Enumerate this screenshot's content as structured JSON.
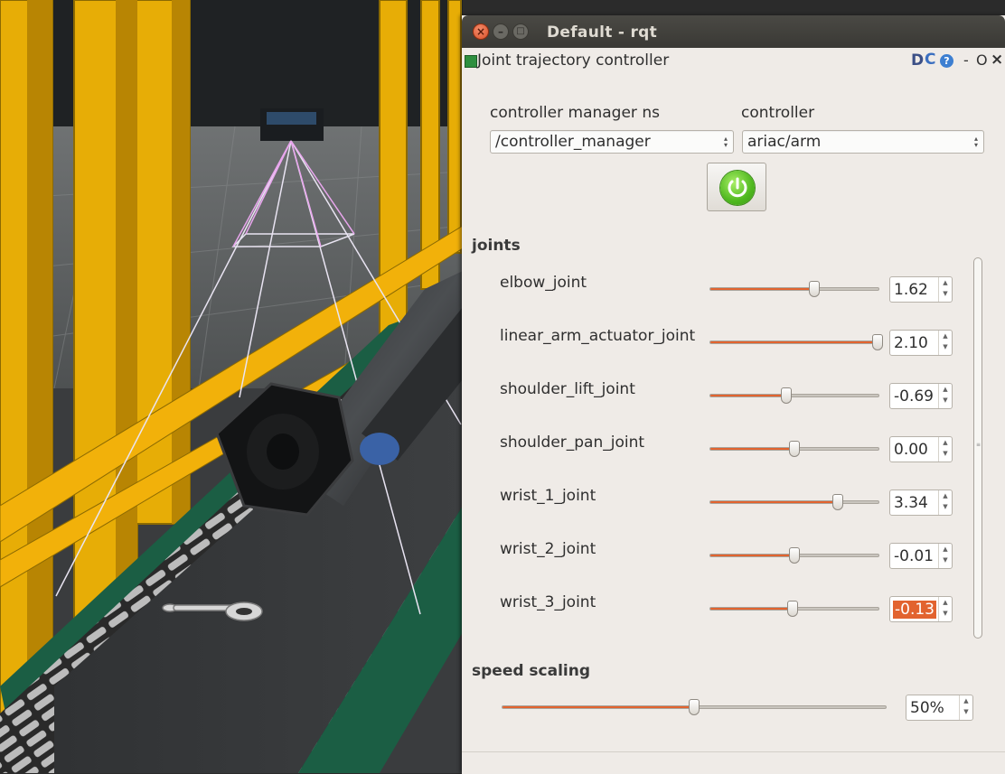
{
  "window": {
    "title": "Default - rqt",
    "controls": {
      "close": "×",
      "minimize": "–",
      "maximize": "□"
    }
  },
  "plugin": {
    "title": "Joint trajectory controller",
    "buttons": {
      "d": "D",
      "reload": "C",
      "help": "?",
      "dash": "-",
      "undock": "O",
      "close": "×"
    }
  },
  "controller_manager_ns": {
    "label": "controller manager ns",
    "value": "/controller_manager"
  },
  "controller": {
    "label": "controller",
    "value": "ariac/arm"
  },
  "power_button": {
    "state": "on",
    "color": "#4fb81f"
  },
  "joints": {
    "header": "joints",
    "items": [
      {
        "name": "elbow_joint",
        "value": "1.62",
        "level": 0.62
      },
      {
        "name": "linear_arm_actuator_joint",
        "value": "2.10",
        "level": 0.995
      },
      {
        "name": "shoulder_lift_joint",
        "value": "-0.69",
        "level": 0.45
      },
      {
        "name": "shoulder_pan_joint",
        "value": "0.00",
        "level": 0.5
      },
      {
        "name": "wrist_1_joint",
        "value": "3.34",
        "level": 0.76
      },
      {
        "name": "wrist_2_joint",
        "value": "-0.01",
        "level": 0.5
      },
      {
        "name": "wrist_3_joint",
        "value": "-0.13",
        "level": 0.49,
        "selected": true
      }
    ]
  },
  "speed_scaling": {
    "header": "speed scaling",
    "value": "50%",
    "level": 0.5
  },
  "accent_color": "#e2632f"
}
